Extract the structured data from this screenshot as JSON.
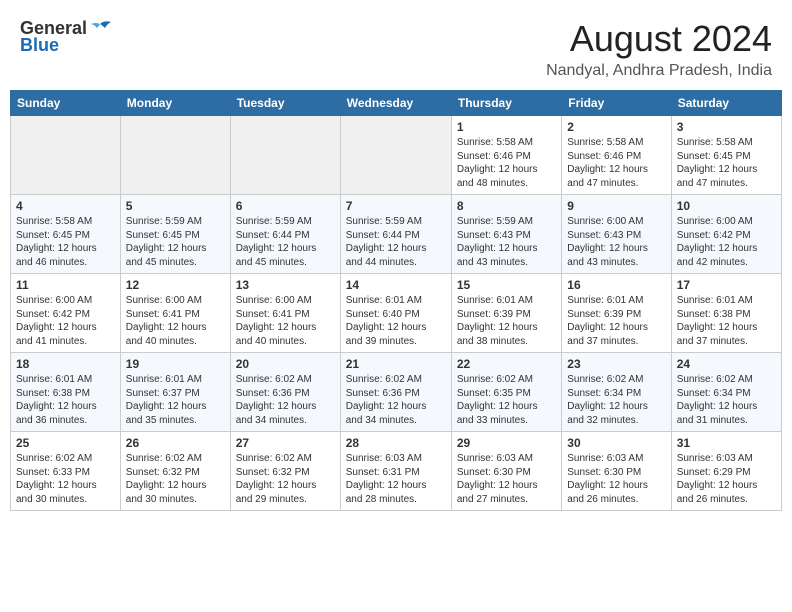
{
  "header": {
    "logo_general": "General",
    "logo_blue": "Blue",
    "month_year": "August 2024",
    "location": "Nandyal, Andhra Pradesh, India"
  },
  "weekdays": [
    "Sunday",
    "Monday",
    "Tuesday",
    "Wednesday",
    "Thursday",
    "Friday",
    "Saturday"
  ],
  "weeks": [
    [
      {
        "day": "",
        "detail": ""
      },
      {
        "day": "",
        "detail": ""
      },
      {
        "day": "",
        "detail": ""
      },
      {
        "day": "",
        "detail": ""
      },
      {
        "day": "1",
        "detail": "Sunrise: 5:58 AM\nSunset: 6:46 PM\nDaylight: 12 hours\nand 48 minutes."
      },
      {
        "day": "2",
        "detail": "Sunrise: 5:58 AM\nSunset: 6:46 PM\nDaylight: 12 hours\nand 47 minutes."
      },
      {
        "day": "3",
        "detail": "Sunrise: 5:58 AM\nSunset: 6:45 PM\nDaylight: 12 hours\nand 47 minutes."
      }
    ],
    [
      {
        "day": "4",
        "detail": "Sunrise: 5:58 AM\nSunset: 6:45 PM\nDaylight: 12 hours\nand 46 minutes."
      },
      {
        "day": "5",
        "detail": "Sunrise: 5:59 AM\nSunset: 6:45 PM\nDaylight: 12 hours\nand 45 minutes."
      },
      {
        "day": "6",
        "detail": "Sunrise: 5:59 AM\nSunset: 6:44 PM\nDaylight: 12 hours\nand 45 minutes."
      },
      {
        "day": "7",
        "detail": "Sunrise: 5:59 AM\nSunset: 6:44 PM\nDaylight: 12 hours\nand 44 minutes."
      },
      {
        "day": "8",
        "detail": "Sunrise: 5:59 AM\nSunset: 6:43 PM\nDaylight: 12 hours\nand 43 minutes."
      },
      {
        "day": "9",
        "detail": "Sunrise: 6:00 AM\nSunset: 6:43 PM\nDaylight: 12 hours\nand 43 minutes."
      },
      {
        "day": "10",
        "detail": "Sunrise: 6:00 AM\nSunset: 6:42 PM\nDaylight: 12 hours\nand 42 minutes."
      }
    ],
    [
      {
        "day": "11",
        "detail": "Sunrise: 6:00 AM\nSunset: 6:42 PM\nDaylight: 12 hours\nand 41 minutes."
      },
      {
        "day": "12",
        "detail": "Sunrise: 6:00 AM\nSunset: 6:41 PM\nDaylight: 12 hours\nand 40 minutes."
      },
      {
        "day": "13",
        "detail": "Sunrise: 6:00 AM\nSunset: 6:41 PM\nDaylight: 12 hours\nand 40 minutes."
      },
      {
        "day": "14",
        "detail": "Sunrise: 6:01 AM\nSunset: 6:40 PM\nDaylight: 12 hours\nand 39 minutes."
      },
      {
        "day": "15",
        "detail": "Sunrise: 6:01 AM\nSunset: 6:39 PM\nDaylight: 12 hours\nand 38 minutes."
      },
      {
        "day": "16",
        "detail": "Sunrise: 6:01 AM\nSunset: 6:39 PM\nDaylight: 12 hours\nand 37 minutes."
      },
      {
        "day": "17",
        "detail": "Sunrise: 6:01 AM\nSunset: 6:38 PM\nDaylight: 12 hours\nand 37 minutes."
      }
    ],
    [
      {
        "day": "18",
        "detail": "Sunrise: 6:01 AM\nSunset: 6:38 PM\nDaylight: 12 hours\nand 36 minutes."
      },
      {
        "day": "19",
        "detail": "Sunrise: 6:01 AM\nSunset: 6:37 PM\nDaylight: 12 hours\nand 35 minutes."
      },
      {
        "day": "20",
        "detail": "Sunrise: 6:02 AM\nSunset: 6:36 PM\nDaylight: 12 hours\nand 34 minutes."
      },
      {
        "day": "21",
        "detail": "Sunrise: 6:02 AM\nSunset: 6:36 PM\nDaylight: 12 hours\nand 34 minutes."
      },
      {
        "day": "22",
        "detail": "Sunrise: 6:02 AM\nSunset: 6:35 PM\nDaylight: 12 hours\nand 33 minutes."
      },
      {
        "day": "23",
        "detail": "Sunrise: 6:02 AM\nSunset: 6:34 PM\nDaylight: 12 hours\nand 32 minutes."
      },
      {
        "day": "24",
        "detail": "Sunrise: 6:02 AM\nSunset: 6:34 PM\nDaylight: 12 hours\nand 31 minutes."
      }
    ],
    [
      {
        "day": "25",
        "detail": "Sunrise: 6:02 AM\nSunset: 6:33 PM\nDaylight: 12 hours\nand 30 minutes."
      },
      {
        "day": "26",
        "detail": "Sunrise: 6:02 AM\nSunset: 6:32 PM\nDaylight: 12 hours\nand 30 minutes."
      },
      {
        "day": "27",
        "detail": "Sunrise: 6:02 AM\nSunset: 6:32 PM\nDaylight: 12 hours\nand 29 minutes."
      },
      {
        "day": "28",
        "detail": "Sunrise: 6:03 AM\nSunset: 6:31 PM\nDaylight: 12 hours\nand 28 minutes."
      },
      {
        "day": "29",
        "detail": "Sunrise: 6:03 AM\nSunset: 6:30 PM\nDaylight: 12 hours\nand 27 minutes."
      },
      {
        "day": "30",
        "detail": "Sunrise: 6:03 AM\nSunset: 6:30 PM\nDaylight: 12 hours\nand 26 minutes."
      },
      {
        "day": "31",
        "detail": "Sunrise: 6:03 AM\nSunset: 6:29 PM\nDaylight: 12 hours\nand 26 minutes."
      }
    ]
  ]
}
